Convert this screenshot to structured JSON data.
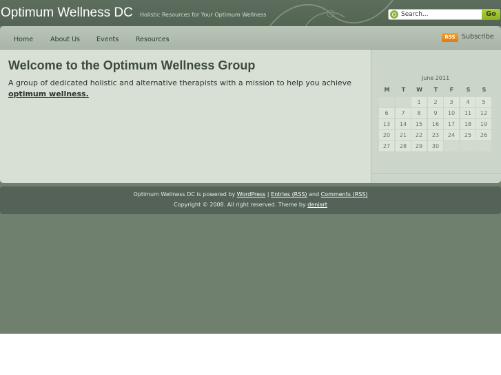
{
  "header": {
    "site_title": "Optimum Wellness DC",
    "site_description": "Holistic Resources for Your Optimum Wellness",
    "search_placeholder": "Search...",
    "go_label": "Go"
  },
  "nav": {
    "items": [
      "Home",
      "About Us",
      "Events",
      "Resources"
    ],
    "rss_badge": "RSS",
    "subscribe_label": "Subscribe"
  },
  "main": {
    "title": "Welcome to the Optimum Wellness Group",
    "intro_text": "A group of dedicated holistic and alternative therapists with a mission to help you achieve ",
    "intro_link": "optimum wellness."
  },
  "calendar": {
    "caption": "June 2011",
    "weekdays": [
      "M",
      "T",
      "W",
      "T",
      "F",
      "S",
      "S"
    ],
    "weeks": [
      [
        "",
        "",
        "1",
        "2",
        "3",
        "4",
        "5"
      ],
      [
        "6",
        "7",
        "8",
        "9",
        "10",
        "11",
        "12"
      ],
      [
        "13",
        "14",
        "15",
        "16",
        "17",
        "18",
        "19"
      ],
      [
        "20",
        "21",
        "22",
        "23",
        "24",
        "25",
        "26"
      ],
      [
        "27",
        "28",
        "29",
        "30",
        "",
        "",
        ""
      ]
    ]
  },
  "footer": {
    "line1_prefix": "Optimum Wellness DC is powered by ",
    "wordpress_link": "WordPress",
    "separator": " | ",
    "entries_link": "Entries (RSS)",
    "and_text": " and ",
    "comments_link": "Comments (RSS)",
    "line2_prefix": "Copyright © 2008. All right reserved. Theme by ",
    "theme_link": "deniart"
  },
  "colors": {
    "page_background": "#6f806f",
    "header": "#5d6e5e",
    "accent_green": "#8db125",
    "rss_orange": "#e0781a"
  }
}
